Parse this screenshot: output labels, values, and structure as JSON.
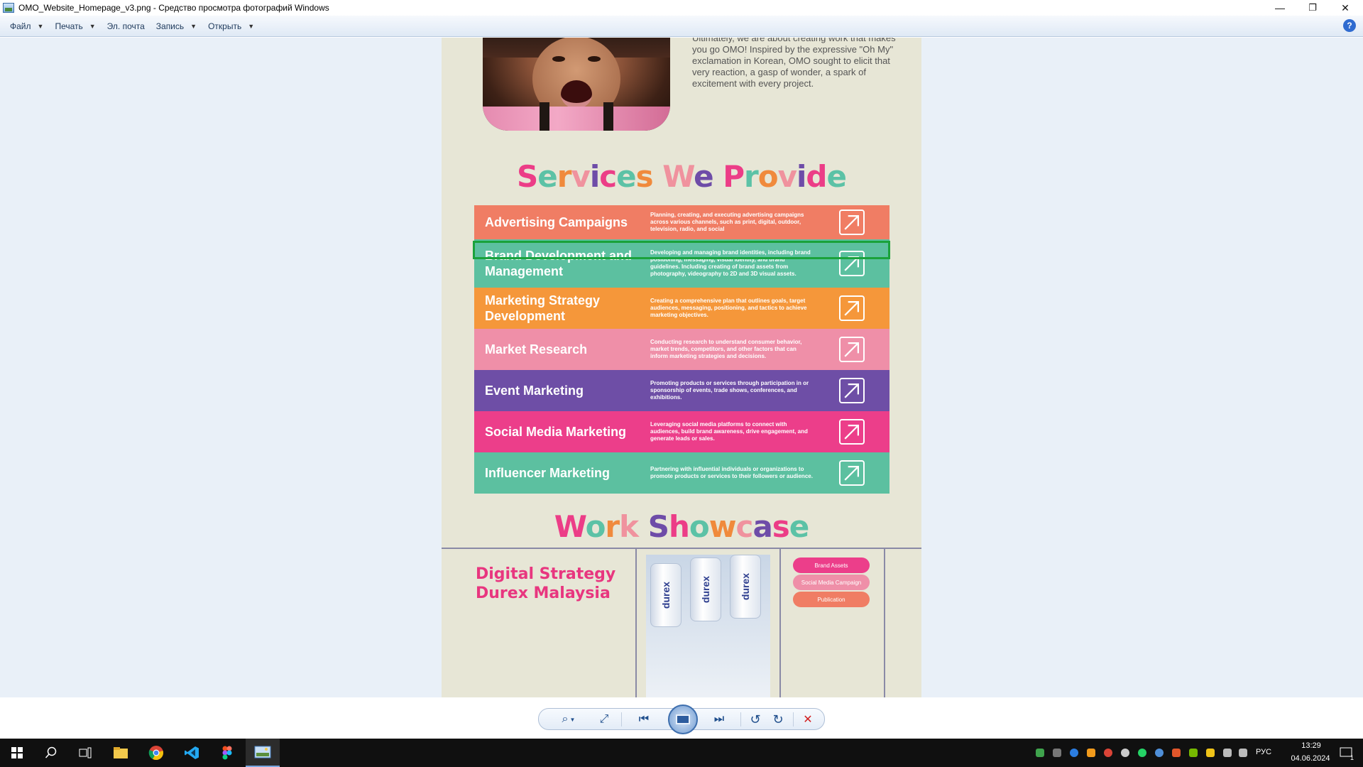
{
  "window": {
    "title": "OMO_Website_Homepage_v3.png - Средство просмотра фотографий Windows",
    "minimize": "—",
    "maximize": "❐",
    "close": "✕"
  },
  "menu": {
    "items": [
      {
        "label": "Файл",
        "has_caret": true
      },
      {
        "label": "Печать",
        "has_caret": true
      },
      {
        "label": "Эл. почта",
        "has_caret": false
      },
      {
        "label": "Запись",
        "has_caret": true
      },
      {
        "label": "Открыть",
        "has_caret": true
      }
    ],
    "help": "?"
  },
  "image": {
    "hero_text": "Ultimately, we are about creating work that makes  you go OMO! Inspired by the expressive \"Oh My\" exclamation in Korean, OMO sought to elicit that very reaction, a gasp of wonder, a spark of excitement with every project.",
    "services_title": "Services We Provide",
    "services_title_colors": [
      "#ec3d87",
      "#5cc2a6",
      "#f08a3c",
      "#f0929e",
      "#6e4ca8"
    ],
    "services": [
      {
        "name": "Advertising Campaigns",
        "desc": "Planning, creating, and executing advertising campaigns across various channels, such as print, digital, outdoor, television, radio, and social",
        "color": "#f07d64"
      },
      {
        "name": "Brand Development and Management",
        "desc": "Developing and managing brand identities, including brand positioning, messaging, visual identity, and brand guidelines. Including creating of brand assets from photography, videography to 2D and 3D visual assets.",
        "color": "#5cc0a0"
      },
      {
        "name": "Marketing Strategy Development",
        "desc": "Creating a comprehensive plan that outlines goals, target audiences, messaging, positioning, and tactics to achieve marketing objectives.",
        "color": "#f5973a"
      },
      {
        "name": "Market Research",
        "desc": "Conducting research to understand consumer behavior, market trends, competitors, and other factors that can inform marketing strategies and decisions.",
        "color": "#ef8fa8"
      },
      {
        "name": "Event Marketing",
        "desc": "Promoting products or services through participation in or sponsorship of events, trade shows, conferences, and exhibitions.",
        "color": "#6e4ea6"
      },
      {
        "name": "Social Media Marketing",
        "desc": "Leveraging social media platforms to connect with audiences, build brand awareness, drive engagement, and generate leads or sales.",
        "color": "#ec3e8a"
      },
      {
        "name": "Influencer Marketing",
        "desc": "Partnering with influential individuals or organizations to promote products or services to their followers or audience.",
        "color": "#5cc0a0"
      }
    ],
    "showcase_title": "Work Showcase",
    "showcase_item_title": "Digital Strategy Durex Malaysia",
    "product_label": "durex",
    "tags": [
      {
        "label": "Brand Assets",
        "color": "#ec3e8a"
      },
      {
        "label": "Social Media Campaign",
        "color": "#ef8fa8"
      },
      {
        "label": "Publication",
        "color": "#f07d64"
      }
    ]
  },
  "toolbar": {
    "zoom_icon": "⌕",
    "fit_icon": "⤢",
    "prev_icon": "⏮",
    "next_icon": "⏭",
    "rotate_ccw_icon": "↺",
    "rotate_cw_icon": "↻",
    "delete_icon": "✕"
  },
  "taskbar": {
    "language": "РУС",
    "time": "13:29",
    "date": "04.06.2024",
    "notifications": "1"
  }
}
